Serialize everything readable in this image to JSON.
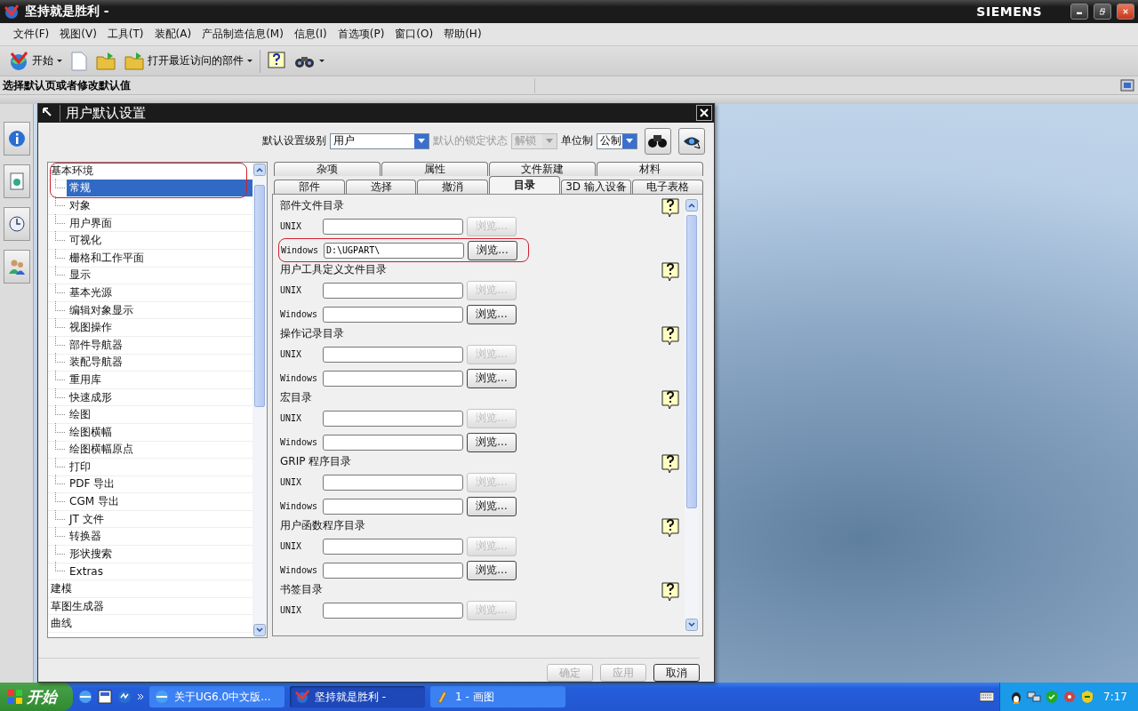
{
  "app": {
    "title": "坚持就是胜利 -",
    "brand": "SIEMENS"
  },
  "menu": [
    "文件(F)",
    "视图(V)",
    "工具(T)",
    "装配(A)",
    "产品制造信息(M)",
    "信息(I)",
    "首选项(P)",
    "窗口(O)",
    "帮助(H)"
  ],
  "toolbar": {
    "start": "开始",
    "recent": "打开最近访问的部件"
  },
  "cue_line": "选择默认页或者修改默认值",
  "dialog": {
    "title": "用户默认设置",
    "controls": [
      {
        "label": "默认设置级别",
        "value": "用户",
        "disabled": false
      },
      {
        "label": "默认的锁定状态",
        "value": "解锁",
        "disabled": true
      },
      {
        "label": "单位制",
        "value": "公制",
        "disabled": false
      }
    ],
    "tree": [
      {
        "label": "基本环境",
        "selected": false,
        "circled": true,
        "children": [
          {
            "label": "常规",
            "selected": true,
            "circled": true
          },
          {
            "label": "对象",
            "selected": false,
            "circled": false
          },
          {
            "label": "用户界面",
            "selected": false,
            "circled": false
          },
          {
            "label": "可视化",
            "selected": false,
            "circled": false
          },
          {
            "label": "栅格和工作平面",
            "selected": false,
            "circled": false
          },
          {
            "label": "显示",
            "selected": false,
            "circled": false
          },
          {
            "label": "基本光源",
            "selected": false,
            "circled": false
          },
          {
            "label": "编辑对象显示",
            "selected": false,
            "circled": false
          },
          {
            "label": "视图操作",
            "selected": false,
            "circled": false
          },
          {
            "label": "部件导航器",
            "selected": false,
            "circled": false
          },
          {
            "label": "装配导航器",
            "selected": false,
            "circled": false
          },
          {
            "label": "重用库",
            "selected": false,
            "circled": false
          },
          {
            "label": "快速成形",
            "selected": false,
            "circled": false
          },
          {
            "label": "绘图",
            "selected": false,
            "circled": false
          },
          {
            "label": "绘图横幅",
            "selected": false,
            "circled": false
          },
          {
            "label": "绘图横幅原点",
            "selected": false,
            "circled": false
          },
          {
            "label": "打印",
            "selected": false,
            "circled": false
          },
          {
            "label": "PDF 导出",
            "selected": false,
            "circled": false
          },
          {
            "label": "CGM 导出",
            "selected": false,
            "circled": false
          },
          {
            "label": "JT 文件",
            "selected": false,
            "circled": false
          },
          {
            "label": "转换器",
            "selected": false,
            "circled": false
          },
          {
            "label": "形状搜索",
            "selected": false,
            "circled": false
          },
          {
            "label": "Extras",
            "selected": false,
            "circled": false
          }
        ]
      },
      {
        "label": "建模",
        "selected": false,
        "circled": false
      },
      {
        "label": "草图生成器",
        "selected": false,
        "circled": false
      },
      {
        "label": "曲线",
        "selected": false,
        "circled": false
      }
    ],
    "tab_rows": [
      [
        {
          "label": "杂项",
          "selected": false
        },
        {
          "label": "属性",
          "selected": false
        },
        {
          "label": "文件新建",
          "selected": false
        },
        {
          "label": "材料",
          "selected": false
        }
      ],
      [
        {
          "label": "部件",
          "selected": false
        },
        {
          "label": "选择",
          "selected": false
        },
        {
          "label": "撤消",
          "selected": false
        },
        {
          "label": "目录",
          "selected": true
        },
        {
          "label": "3D 输入设备",
          "selected": false
        },
        {
          "label": "电子表格",
          "selected": false
        }
      ]
    ],
    "sections": [
      {
        "title": "部件文件目录",
        "rows": [
          {
            "label": "UNIX",
            "button": "浏览...",
            "disabled": true,
            "circled": false
          },
          {
            "label": "Windows",
            "value": "D:\\UGPART\\",
            "button": "浏览...",
            "disabled": false,
            "circled": true
          }
        ]
      },
      {
        "title": "用户工具定义文件目录",
        "rows": [
          {
            "label": "UNIX",
            "button": "浏览...",
            "disabled": true,
            "circled": false
          },
          {
            "label": "Windows",
            "button": "浏览...",
            "disabled": false,
            "circled": false
          }
        ]
      },
      {
        "title": "操作记录目录",
        "rows": [
          {
            "label": "UNIX",
            "button": "浏览...",
            "disabled": true,
            "circled": false
          },
          {
            "label": "Windows",
            "button": "浏览...",
            "disabled": false,
            "circled": false
          }
        ]
      },
      {
        "title": "宏目录",
        "rows": [
          {
            "label": "UNIX",
            "button": "浏览...",
            "disabled": true,
            "circled": false
          },
          {
            "label": "Windows",
            "button": "浏览...",
            "disabled": false,
            "circled": false
          }
        ]
      },
      {
        "title": "GRIP 程序目录",
        "rows": [
          {
            "label": "UNIX",
            "button": "浏览...",
            "disabled": true,
            "circled": false
          },
          {
            "label": "Windows",
            "button": "浏览...",
            "disabled": false,
            "circled": false
          }
        ]
      },
      {
        "title": "用户函数程序目录",
        "rows": [
          {
            "label": "UNIX",
            "button": "浏览...",
            "disabled": true,
            "circled": false
          },
          {
            "label": "Windows",
            "button": "浏览...",
            "disabled": false,
            "circled": false
          }
        ]
      },
      {
        "title": "书签目录",
        "rows": [
          {
            "label": "UNIX",
            "button": "浏览...",
            "disabled": true,
            "circled": false
          }
        ]
      }
    ],
    "buttons": [
      {
        "label": "确定",
        "disabled": true
      },
      {
        "label": "应用",
        "disabled": true
      },
      {
        "label": "取消",
        "disabled": false
      }
    ]
  },
  "taskbar": {
    "start": "开始",
    "tasks": [
      {
        "label": "关于UG6.0中文版...",
        "selected": false
      },
      {
        "label": "坚持就是胜利 -",
        "selected": true
      },
      {
        "label": "1 - 画图",
        "selected": false
      }
    ],
    "clock": "7:17"
  }
}
